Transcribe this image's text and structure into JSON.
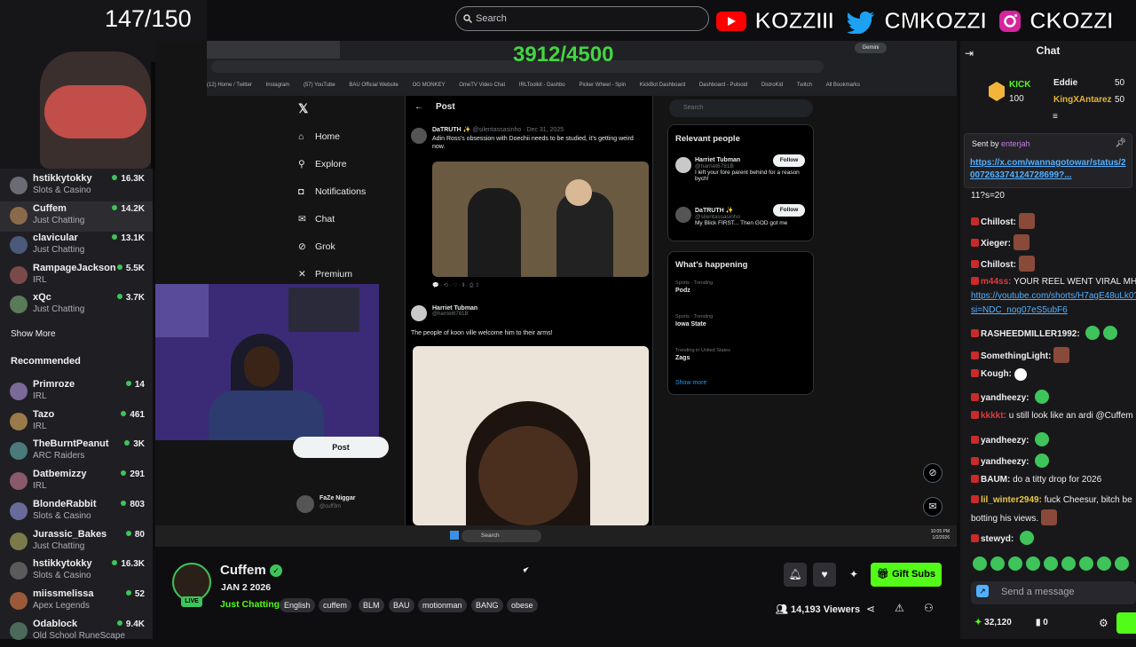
{
  "counter": "147/150",
  "sub_goal": "3912/4500",
  "top_search_placeholder": "Search",
  "socials": [
    {
      "icon": "youtube-icon",
      "handle": "KOZZIII"
    },
    {
      "icon": "twitter-icon",
      "handle": "CMKOZZI"
    },
    {
      "icon": "instagram-icon",
      "handle": "CKOZZI"
    }
  ],
  "sidebar": {
    "following": [
      {
        "name": "hstikkytokky",
        "category": "Slots & Casino",
        "viewers": "16.3K"
      },
      {
        "name": "Cuffem",
        "category": "Just Chatting",
        "viewers": "14.2K"
      },
      {
        "name": "clavicular",
        "category": "Just Chatting",
        "viewers": "13.1K"
      },
      {
        "name": "RampageJackson",
        "category": "IRL",
        "viewers": "5.5K"
      },
      {
        "name": "xQc",
        "category": "Just Chatting",
        "viewers": "3.7K"
      }
    ],
    "show_more": "Show More",
    "recommended_title": "Recommended",
    "recommended": [
      {
        "name": "Primroze",
        "category": "IRL",
        "viewers": "14"
      },
      {
        "name": "Tazo",
        "category": "IRL",
        "viewers": "461"
      },
      {
        "name": "TheBurntPeanut",
        "category": "ARC Raiders",
        "viewers": "3K"
      },
      {
        "name": "Datbemizzy",
        "category": "IRL",
        "viewers": "291"
      },
      {
        "name": "BlondeRabbit",
        "category": "Slots & Casino",
        "viewers": "803"
      },
      {
        "name": "Jurassic_Bakes",
        "category": "Just Chatting",
        "viewers": "80"
      },
      {
        "name": "hstikkytokky",
        "category": "Slots & Casino",
        "viewers": "16.3K"
      },
      {
        "name": "miissmelissa",
        "category": "Apex Legends",
        "viewers": "52"
      },
      {
        "name": "Odablock",
        "category": "Old School RuneScape",
        "viewers": "9.4K"
      }
    ]
  },
  "browser": {
    "bookmarks": [
      "(12) Home / Twitter",
      "Instagram",
      "(57) YouTube",
      "BAU Official Website",
      "OG MONKEY",
      "OmeTV Video Chat",
      "IRLToolkit - Dashbo",
      "Picker Wheel - Spin",
      "KickBot Dashboard",
      "Dashboard - Pulsoid",
      "DistroKid",
      "Twitch",
      "All Bookmarks"
    ]
  },
  "x": {
    "nav": [
      {
        "icon": "home-icon",
        "label": "Home"
      },
      {
        "icon": "explore-icon",
        "label": "Explore"
      },
      {
        "icon": "bell-icon",
        "label": "Notifications"
      },
      {
        "icon": "chat-icon",
        "label": "Chat"
      },
      {
        "icon": "grok-icon",
        "label": "Grok"
      },
      {
        "icon": "x-logo-icon",
        "label": "Premium"
      }
    ],
    "post_button": "Post",
    "header": "Post",
    "search_placeholder": "Search",
    "tweet1": {
      "author": "DaTRUTH ✨",
      "handle": "@silentassasinho · Dec 31, 2025",
      "text": "Adin Ross's obsession with Doechii needs to be studied, it's getting weird now."
    },
    "tweet2": {
      "author": "Harriet Tubman",
      "handle": "@harriet6781B",
      "text": "The people of koon ville welcome him to their arms!"
    },
    "relevant_title": "Relevant people",
    "people": [
      {
        "name": "Harriet Tubman",
        "handle": "@harriet6781B",
        "bio": "I left your fore parent behind for a reason bych!",
        "follow": "Follow"
      },
      {
        "name": "DaTRUTH ✨",
        "handle": "@silentassasinho",
        "bio": "My Blick FIRST... Then GOD got me",
        "follow": "Follow"
      }
    ],
    "happening_title": "What's happening",
    "trends": [
      {
        "meta": "Sports · Trending",
        "name": "Podz"
      },
      {
        "meta": "Sports · Trending",
        "name": "Iowa State"
      },
      {
        "meta": "Trending in United States",
        "name": "Zags"
      }
    ],
    "show_more": "Show more",
    "account_name": "FaZe Niggar",
    "account_handle": "@cuff3m"
  },
  "taskbar": {
    "search": "Search",
    "time": "10:05 PM",
    "date": "1/2/2026"
  },
  "stream": {
    "name": "Cuffem",
    "date": "JAN 2 2026",
    "category": "Just Chatting",
    "live": "LIVE",
    "tags": [
      "English",
      "cuffem",
      "BLM",
      "BAU",
      "motionman",
      "BANG",
      "obese"
    ],
    "viewers": "14,193 Viewers",
    "gift": "Gift Subs"
  },
  "chat": {
    "title": "Chat",
    "top_gifters": [
      {
        "name": "KICK",
        "amount": "100"
      },
      {
        "name": "Eddie",
        "amount": "50"
      },
      {
        "name": "KingXAntarez",
        "amount": "50"
      }
    ],
    "pinned_sender": "Sent by",
    "pinned_user": "enterjah",
    "pinned_link": "https://x.com/wannagotowar/status/2007263374124728699?...",
    "messages": [
      {
        "user": "",
        "text": "11?s=20"
      },
      {
        "user": "Chillost:",
        "text": ""
      },
      {
        "user": "Xieger:",
        "text": ""
      },
      {
        "user": "Chillost:",
        "text": ""
      },
      {
        "user": "m44ss:",
        "text": "YOUR REEL WENT VIRAL MH"
      },
      {
        "user": "",
        "text": "https://youtube.com/shorts/H7agE48uLk0?"
      },
      {
        "user": "",
        "text": "si=NDC_nog07eS5ubF6"
      },
      {
        "user": "RASHEEDMILLER1992:",
        "text": ""
      },
      {
        "user": "SomethingLight:",
        "text": ""
      },
      {
        "user": "Kough:",
        "text": ""
      },
      {
        "user": "yandheezy:",
        "text": ""
      },
      {
        "user": "kkkkt:",
        "text": "u still look like an ardi @Cuffem"
      },
      {
        "user": "yandheezy:",
        "text": ""
      },
      {
        "user": "yandheezy:",
        "text": ""
      },
      {
        "user": "BAUM:",
        "text": "do a titty drop for 2026"
      },
      {
        "user": "lil_winter2949:",
        "text": "fuck Cheesur, bitch be"
      },
      {
        "user": "",
        "text": "botting his views."
      },
      {
        "user": "stewyd:",
        "text": ""
      }
    ],
    "input_placeholder": "Send a message",
    "points": "32,120",
    "bits": "0"
  },
  "colors": {
    "kick_green": "#53fc18",
    "link": "#53b0ff",
    "bg": "#0e0e10"
  }
}
